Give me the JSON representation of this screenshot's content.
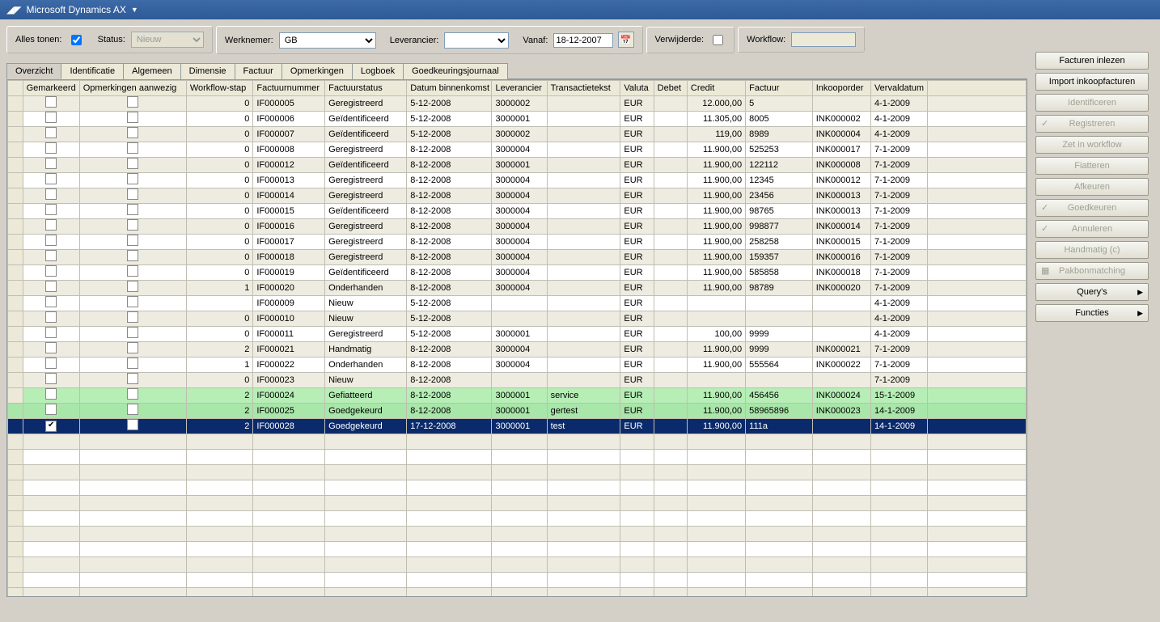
{
  "app_title": "Microsoft Dynamics AX",
  "filters": {
    "alles_tonen_label": "Alles tonen:",
    "alles_tonen_checked": true,
    "status_label": "Status:",
    "status_value": "Nieuw",
    "werknemer_label": "Werknemer:",
    "werknemer_value": "GB",
    "leverancier_label": "Leverancier:",
    "leverancier_value": "",
    "vanaf_label": "Vanaf:",
    "vanaf_value": "18-12-2007",
    "verwijderde_label": "Verwijderde:",
    "verwijderde_checked": false,
    "workflow_label": "Workflow:",
    "workflow_value": ""
  },
  "tabs": [
    {
      "label": "Overzicht",
      "active": true
    },
    {
      "label": "Identificatie"
    },
    {
      "label": "Algemeen"
    },
    {
      "label": "Dimensie"
    },
    {
      "label": "Factuur"
    },
    {
      "label": "Opmerkingen"
    },
    {
      "label": "Logboek"
    },
    {
      "label": "Goedkeuringsjournaal"
    }
  ],
  "actions": [
    {
      "label": "Facturen inlezen",
      "enabled": true
    },
    {
      "label": "Import inkoopfacturen",
      "enabled": true
    },
    {
      "label": "Identificeren",
      "enabled": false
    },
    {
      "label": "Registreren",
      "enabled": false,
      "icon": "✓"
    },
    {
      "label": "Zet in workflow",
      "enabled": false
    },
    {
      "label": "Fiatteren",
      "enabled": false
    },
    {
      "label": "Afkeuren",
      "enabled": false
    },
    {
      "label": "Goedkeuren",
      "enabled": false,
      "icon": "✓"
    },
    {
      "label": "Annuleren",
      "enabled": false,
      "icon": "✓"
    },
    {
      "label": "Handmatig (c)",
      "enabled": false
    },
    {
      "label": "Pakbonmatching",
      "enabled": false,
      "icon": "▦"
    },
    {
      "label": "Query's",
      "enabled": true,
      "menu": true
    },
    {
      "label": "Functies",
      "enabled": true,
      "menu": true
    }
  ],
  "grid": {
    "columns": [
      {
        "key": "mark",
        "label": "Gemarkeerd",
        "w": 68,
        "type": "check"
      },
      {
        "key": "opm",
        "label": "Opmerkingen aanwezig",
        "w": 128,
        "type": "check"
      },
      {
        "key": "wfstap",
        "label": "Workflow-stap",
        "w": 80,
        "align": "right"
      },
      {
        "key": "fnr",
        "label": "Factuurnummer",
        "w": 86
      },
      {
        "key": "fstat",
        "label": "Factuurstatus",
        "w": 98
      },
      {
        "key": "datum",
        "label": "Datum binnenkomst",
        "w": 102
      },
      {
        "key": "lev",
        "label": "Leverancier",
        "w": 66
      },
      {
        "key": "ttekst",
        "label": "Transactietekst",
        "w": 88
      },
      {
        "key": "val",
        "label": "Valuta",
        "w": 40
      },
      {
        "key": "debet",
        "label": "Debet",
        "w": 40,
        "align": "right"
      },
      {
        "key": "credit",
        "label": "Credit",
        "w": 70,
        "align": "right"
      },
      {
        "key": "factuur",
        "label": "Factuur",
        "w": 80
      },
      {
        "key": "inkoop",
        "label": "Inkooporder",
        "w": 70
      },
      {
        "key": "verval",
        "label": "Vervaldatum",
        "w": 68
      },
      {
        "key": "extra",
        "label": "",
        "w": 118
      }
    ],
    "rows": [
      {
        "mark": false,
        "wfstap": "0",
        "fnr": "IF000005",
        "fstat": "Geregistreerd",
        "datum": "5-12-2008",
        "lev": "3000002",
        "ttekst": "",
        "val": "EUR",
        "debet": "",
        "credit": "12.000,00",
        "factuur": "5",
        "inkoop": "",
        "verval": "4-1-2009"
      },
      {
        "mark": false,
        "wfstap": "0",
        "fnr": "IF000006",
        "fstat": "Geïdentificeerd",
        "datum": "5-12-2008",
        "lev": "3000001",
        "ttekst": "",
        "val": "EUR",
        "debet": "",
        "credit": "11.305,00",
        "factuur": "8005",
        "inkoop": "INK000002",
        "verval": "4-1-2009"
      },
      {
        "mark": false,
        "wfstap": "0",
        "fnr": "IF000007",
        "fstat": "Geïdentificeerd",
        "datum": "5-12-2008",
        "lev": "3000002",
        "ttekst": "",
        "val": "EUR",
        "debet": "",
        "credit": "119,00",
        "factuur": "8989",
        "inkoop": "INK000004",
        "verval": "4-1-2009"
      },
      {
        "mark": false,
        "wfstap": "0",
        "fnr": "IF000008",
        "fstat": "Geregistreerd",
        "datum": "8-12-2008",
        "lev": "3000004",
        "ttekst": "",
        "val": "EUR",
        "debet": "",
        "credit": "11.900,00",
        "factuur": "525253",
        "inkoop": "INK000017",
        "verval": "7-1-2009"
      },
      {
        "mark": false,
        "wfstap": "0",
        "fnr": "IF000012",
        "fstat": "Geïdentificeerd",
        "datum": "8-12-2008",
        "lev": "3000001",
        "ttekst": "",
        "val": "EUR",
        "debet": "",
        "credit": "11.900,00",
        "factuur": "122112",
        "inkoop": "INK000008",
        "verval": "7-1-2009"
      },
      {
        "mark": false,
        "wfstap": "0",
        "fnr": "IF000013",
        "fstat": "Geregistreerd",
        "datum": "8-12-2008",
        "lev": "3000004",
        "ttekst": "",
        "val": "EUR",
        "debet": "",
        "credit": "11.900,00",
        "factuur": "12345",
        "inkoop": "INK000012",
        "verval": "7-1-2009"
      },
      {
        "mark": false,
        "wfstap": "0",
        "fnr": "IF000014",
        "fstat": "Geregistreerd",
        "datum": "8-12-2008",
        "lev": "3000004",
        "ttekst": "",
        "val": "EUR",
        "debet": "",
        "credit": "11.900,00",
        "factuur": "23456",
        "inkoop": "INK000013",
        "verval": "7-1-2009"
      },
      {
        "mark": false,
        "wfstap": "0",
        "fnr": "IF000015",
        "fstat": "Geïdentificeerd",
        "datum": "8-12-2008",
        "lev": "3000004",
        "ttekst": "",
        "val": "EUR",
        "debet": "",
        "credit": "11.900,00",
        "factuur": "98765",
        "inkoop": "INK000013",
        "verval": "7-1-2009"
      },
      {
        "mark": false,
        "wfstap": "0",
        "fnr": "IF000016",
        "fstat": "Geregistreerd",
        "datum": "8-12-2008",
        "lev": "3000004",
        "ttekst": "",
        "val": "EUR",
        "debet": "",
        "credit": "11.900,00",
        "factuur": "998877",
        "inkoop": "INK000014",
        "verval": "7-1-2009"
      },
      {
        "mark": false,
        "wfstap": "0",
        "fnr": "IF000017",
        "fstat": "Geregistreerd",
        "datum": "8-12-2008",
        "lev": "3000004",
        "ttekst": "",
        "val": "EUR",
        "debet": "",
        "credit": "11.900,00",
        "factuur": "258258",
        "inkoop": "INK000015",
        "verval": "7-1-2009"
      },
      {
        "mark": false,
        "wfstap": "0",
        "fnr": "IF000018",
        "fstat": "Geregistreerd",
        "datum": "8-12-2008",
        "lev": "3000004",
        "ttekst": "",
        "val": "EUR",
        "debet": "",
        "credit": "11.900,00",
        "factuur": "159357",
        "inkoop": "INK000016",
        "verval": "7-1-2009"
      },
      {
        "mark": false,
        "wfstap": "0",
        "fnr": "IF000019",
        "fstat": "Geïdentificeerd",
        "datum": "8-12-2008",
        "lev": "3000004",
        "ttekst": "",
        "val": "EUR",
        "debet": "",
        "credit": "11.900,00",
        "factuur": "585858",
        "inkoop": "INK000018",
        "verval": "7-1-2009"
      },
      {
        "mark": false,
        "wfstap": "1",
        "fnr": "IF000020",
        "fstat": "Onderhanden",
        "datum": "8-12-2008",
        "lev": "3000004",
        "ttekst": "",
        "val": "EUR",
        "debet": "",
        "credit": "11.900,00",
        "factuur": "98789",
        "inkoop": "INK000020",
        "verval": "7-1-2009"
      },
      {
        "mark": false,
        "wfstap": "",
        "fnr": "IF000009",
        "fstat": "Nieuw",
        "datum": "5-12-2008",
        "lev": "",
        "ttekst": "",
        "val": "EUR",
        "debet": "",
        "credit": "",
        "factuur": "",
        "inkoop": "",
        "verval": "4-1-2009"
      },
      {
        "mark": false,
        "wfstap": "0",
        "fnr": "IF000010",
        "fstat": "Nieuw",
        "datum": "5-12-2008",
        "lev": "",
        "ttekst": "",
        "val": "EUR",
        "debet": "",
        "credit": "",
        "factuur": "",
        "inkoop": "",
        "verval": "4-1-2009"
      },
      {
        "mark": false,
        "wfstap": "0",
        "fnr": "IF000011",
        "fstat": "Geregistreerd",
        "datum": "5-12-2008",
        "lev": "3000001",
        "ttekst": "",
        "val": "EUR",
        "debet": "",
        "credit": "100,00",
        "factuur": "9999",
        "inkoop": "",
        "verval": "4-1-2009"
      },
      {
        "mark": false,
        "wfstap": "2",
        "fnr": "IF000021",
        "fstat": "Handmatig",
        "datum": "8-12-2008",
        "lev": "3000004",
        "ttekst": "",
        "val": "EUR",
        "debet": "",
        "credit": "11.900,00",
        "factuur": "9999",
        "inkoop": "INK000021",
        "verval": "7-1-2009"
      },
      {
        "mark": false,
        "wfstap": "1",
        "fnr": "IF000022",
        "fstat": "Onderhanden",
        "datum": "8-12-2008",
        "lev": "3000004",
        "ttekst": "",
        "val": "EUR",
        "debet": "",
        "credit": "11.900,00",
        "factuur": "555564",
        "inkoop": "INK000022",
        "verval": "7-1-2009"
      },
      {
        "mark": false,
        "wfstap": "0",
        "fnr": "IF000023",
        "fstat": "Nieuw",
        "datum": "8-12-2008",
        "lev": "",
        "ttekst": "",
        "val": "EUR",
        "debet": "",
        "credit": "",
        "factuur": "",
        "inkoop": "",
        "verval": "7-1-2009"
      },
      {
        "mark": false,
        "wfstap": "2",
        "fnr": "IF000024",
        "fstat": "Gefiatteerd",
        "datum": "8-12-2008",
        "lev": "3000001",
        "ttekst": "service",
        "val": "EUR",
        "debet": "",
        "credit": "11.900,00",
        "factuur": "456456",
        "inkoop": "INK000024",
        "verval": "15-1-2009",
        "style": "green"
      },
      {
        "mark": false,
        "wfstap": "2",
        "fnr": "IF000025",
        "fstat": "Goedgekeurd",
        "datum": "8-12-2008",
        "lev": "3000001",
        "ttekst": "gertest",
        "val": "EUR",
        "debet": "",
        "credit": "11.900,00",
        "factuur": "58965896",
        "inkoop": "INK000023",
        "verval": "14-1-2009",
        "style": "green"
      },
      {
        "mark": true,
        "wfstap": "2",
        "fnr": "IF000028",
        "fstat": "Goedgekeurd",
        "datum": "17-12-2008",
        "lev": "3000001",
        "ttekst": "test",
        "val": "EUR",
        "debet": "",
        "credit": "11.900,00",
        "factuur": "111a",
        "inkoop": "",
        "verval": "14-1-2009",
        "style": "sel"
      }
    ],
    "filler_rows": 11
  }
}
